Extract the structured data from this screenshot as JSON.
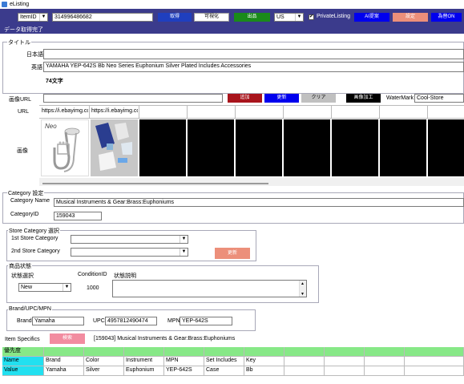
{
  "window": {
    "title": "eListing"
  },
  "toolbar": {
    "id_type": "ItemID",
    "item_id": "314996486682",
    "btn1": "取得",
    "btn2": "可視化",
    "btn3": "出品",
    "site": "US",
    "private_label": "PrivateListing",
    "private_checked": "✔",
    "btn_ai": "AI提案",
    "btn_setting": "設定",
    "btn_auto": "為替ON"
  },
  "status": {
    "text": "データ取得完了"
  },
  "title_section": {
    "legend": "タイトル",
    "japanese_label": "日本語",
    "japanese_value": "",
    "english_label": "英語",
    "english_value": "YAMAHA YEP-642S Bb Neo Series Euphonium Silver Plated Includes Accessories",
    "char_count": "74文字"
  },
  "image_section": {
    "image_url_label": "画像URL",
    "image_url_value": "",
    "btn_add": "追加",
    "btn_update": "更新",
    "btn_clear": "クリア",
    "btn_process": "画像加工",
    "watermark_label": "WaterMark",
    "watermark_value": "Cool-Store",
    "url_label": "URL",
    "url1": "https://i.ebayimg.cc",
    "url2": "https://i.ebayimg.cc",
    "images_label": "画像",
    "neo_text": "Neo"
  },
  "category_section": {
    "legend": "Category 設定",
    "name_label": "Category Name",
    "name_value": "Musical Instruments & Gear:Brass:Euphoniums",
    "id_label": "CategoryID",
    "id_value": "159043"
  },
  "store_category": {
    "legend": "Store Category 選択",
    "first_label": "1st Store Category",
    "second_label": "2nd Store Category",
    "btn_update": "更新"
  },
  "condition_section": {
    "legend": "商品状態",
    "select_label": "状態選択",
    "select_value": "New",
    "condition_id_label": "ConditionID",
    "condition_id_value": "1000",
    "desc_label": "状態説明"
  },
  "brand_section": {
    "legend": "Brand/UPC/MPN",
    "brand_label": "Brand",
    "brand_value": "Yamaha",
    "upc_label": "UPC",
    "upc_value": "4957812490474",
    "mpn_label": "MPN",
    "mpn_value": "YEP-642S"
  },
  "item_specifics": {
    "label": "Item Specifics",
    "btn": "検索",
    "category_text": "[159043] Musical Instruments & Gear:Brass:Euphoniums",
    "header": "優先度",
    "rows": [
      {
        "cells": [
          "Name",
          "Brand",
          "Color",
          "Instrument",
          "MPN",
          "Set Includes",
          "Key",
          "",
          "",
          "",
          ""
        ]
      },
      {
        "cells": [
          "Value",
          "Yamaha",
          "Silver",
          "Euphonium",
          "YEP-642S",
          "Case",
          "Bb",
          "",
          "",
          "",
          ""
        ]
      }
    ]
  }
}
